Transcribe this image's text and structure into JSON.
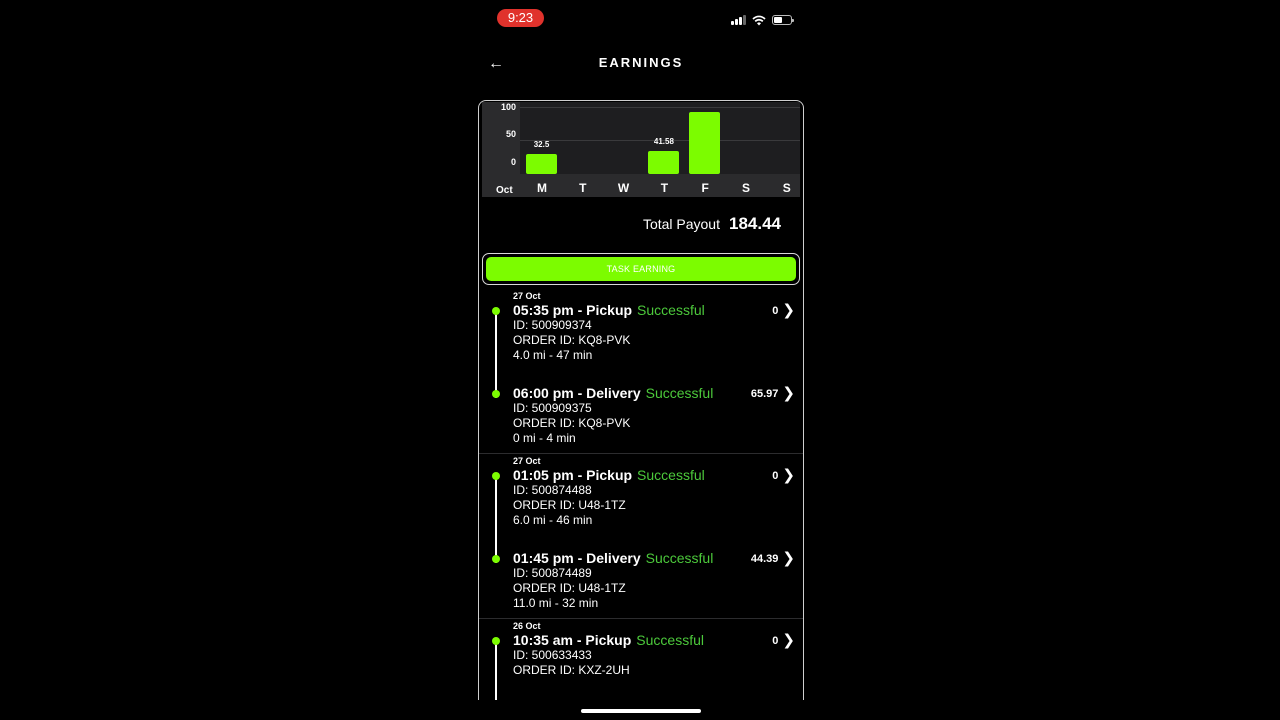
{
  "status_bar": {
    "time": "9:23"
  },
  "header": {
    "title": "EARNINGS",
    "back_icon": "arrow-left-icon"
  },
  "chart_data": {
    "type": "bar",
    "month": "Oct",
    "categories": [
      "M",
      "T",
      "W",
      "T",
      "F",
      "S",
      "S"
    ],
    "values": [
      32.5,
      0,
      0,
      41.58,
      110.36,
      0,
      0
    ],
    "data_labels": [
      "32.5",
      "",
      "",
      "41.58",
      "",
      "",
      ""
    ],
    "yticks": [
      "100",
      "50",
      "0"
    ],
    "colors": {
      "bar": "#7cfc00",
      "plot_bg": "#1e1e20"
    }
  },
  "total": {
    "label": "Total Payout",
    "value": "184.44"
  },
  "tab": {
    "label": "TASK EARNING"
  },
  "groups": [
    {
      "date": "27 Oct",
      "entries": [
        {
          "time_type": "05:35 pm - Pickup",
          "status": "Successful",
          "id": "ID: 500909374",
          "order": "ORDER ID: KQ8-PVK",
          "distance": "4.0 mi - 47 min",
          "amount": "0"
        },
        {
          "time_type": "06:00 pm - Delivery",
          "status": "Successful",
          "id": "ID: 500909375",
          "order": "ORDER ID: KQ8-PVK",
          "distance": "0 mi - 4 min",
          "amount": "65.97"
        }
      ]
    },
    {
      "date": "27 Oct",
      "entries": [
        {
          "time_type": "01:05 pm - Pickup",
          "status": "Successful",
          "id": "ID: 500874488",
          "order": "ORDER ID: U48-1TZ",
          "distance": "6.0 mi - 46 min",
          "amount": "0"
        },
        {
          "time_type": "01:45 pm - Delivery",
          "status": "Successful",
          "id": "ID: 500874489",
          "order": "ORDER ID: U48-1TZ",
          "distance": "11.0 mi - 32 min",
          "amount": "44.39"
        }
      ]
    },
    {
      "date": "26 Oct",
      "entries": [
        {
          "time_type": "10:35 am - Pickup",
          "status": "Successful",
          "id": "ID: 500633433",
          "order": "ORDER ID: KXZ-2UH",
          "distance": "",
          "amount": "0"
        }
      ]
    }
  ]
}
